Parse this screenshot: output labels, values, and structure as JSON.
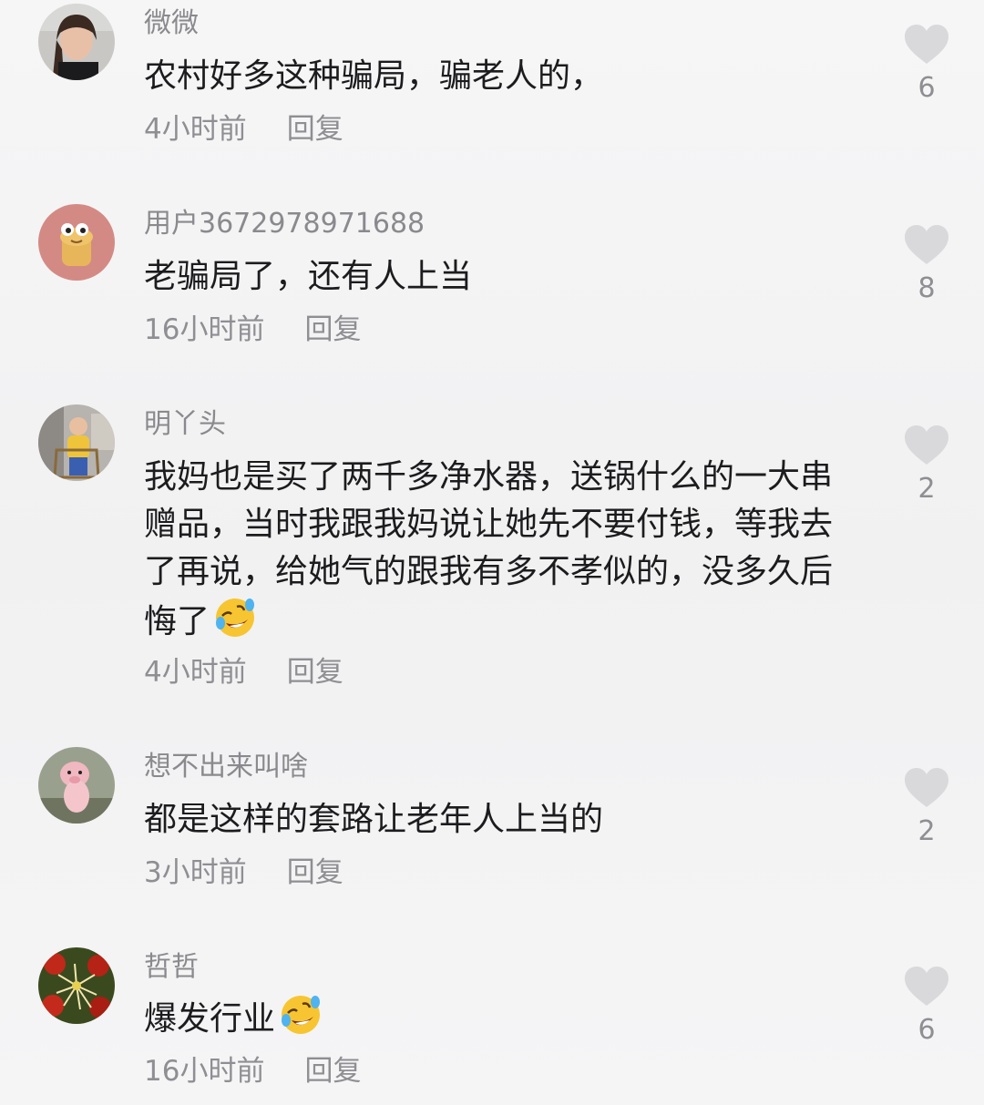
{
  "comments": [
    {
      "username": "微微",
      "text": "农村好多这种骗局，骗老人的，",
      "time": "4小时前",
      "reply": "回复",
      "likes": "6"
    },
    {
      "username": "用户3672978971688",
      "text": "老骗局了，还有人上当",
      "time": "16小时前",
      "reply": "回复",
      "likes": "8"
    },
    {
      "username": "明丫头",
      "text": "我妈也是买了两千多净水器，送锅什么的一大串赠品，当时我跟我妈说让她先不要付钱，等我去了再说，给她气的跟我有多不孝似的，没多久后悔了",
      "emoji": "rolling-laughing-emoji",
      "time": "4小时前",
      "reply": "回复",
      "likes": "2"
    },
    {
      "username": "想不出来叫啥",
      "text": "都是这样的套路让老年人上当的",
      "time": "3小时前",
      "reply": "回复",
      "likes": "2"
    },
    {
      "username": "哲哲",
      "text": "爆发行业",
      "emoji": "rolling-laughing-emoji",
      "time": "16小时前",
      "reply": "回复",
      "likes": "6"
    }
  ],
  "colors": {
    "text": "#1c1c1e",
    "secondary": "#8e8e93",
    "heart": "#d9d9dc"
  }
}
